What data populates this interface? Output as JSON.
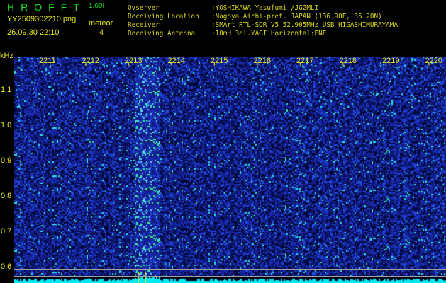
{
  "header": {
    "app_title": "HROFFT",
    "version": "1.00f",
    "filename": "YY2509302210.png",
    "datetime": "26.09.30 22:10",
    "meteor_label": "meteor",
    "meteor_count": "4"
  },
  "info": [
    {
      "label": "Ovserver",
      "value": ":YOSHIKAWA Yasufumi /JG2MLI"
    },
    {
      "label": "Receiving Location",
      "value": ":Nagoya Aichi-pref. JAPAN (136.90E, 35.20N)"
    },
    {
      "label": "Receiver",
      "value": ":SMArt RTL-SDR V5 52.905MHz USB HIGASHIMURAYAMA"
    },
    {
      "label": "Receiving Antenna",
      "value": ":10mH 3el.YAGI Horizontal:ENE"
    }
  ],
  "axis": {
    "y_unit": "kHz",
    "y_ticks": [
      "1.1",
      "1.0",
      "0.9",
      "0.8",
      "0.7",
      "0.6"
    ],
    "x_ticks": [
      "2211",
      "2212",
      "2213",
      "2214",
      "2215",
      "2216",
      "2217",
      "2218",
      "2219",
      "2220"
    ]
  },
  "colors": {
    "green": "#1ee81e",
    "yellow": "#e8e81e",
    "noise": "#1020a0",
    "baseline": "#00e8f0"
  }
}
